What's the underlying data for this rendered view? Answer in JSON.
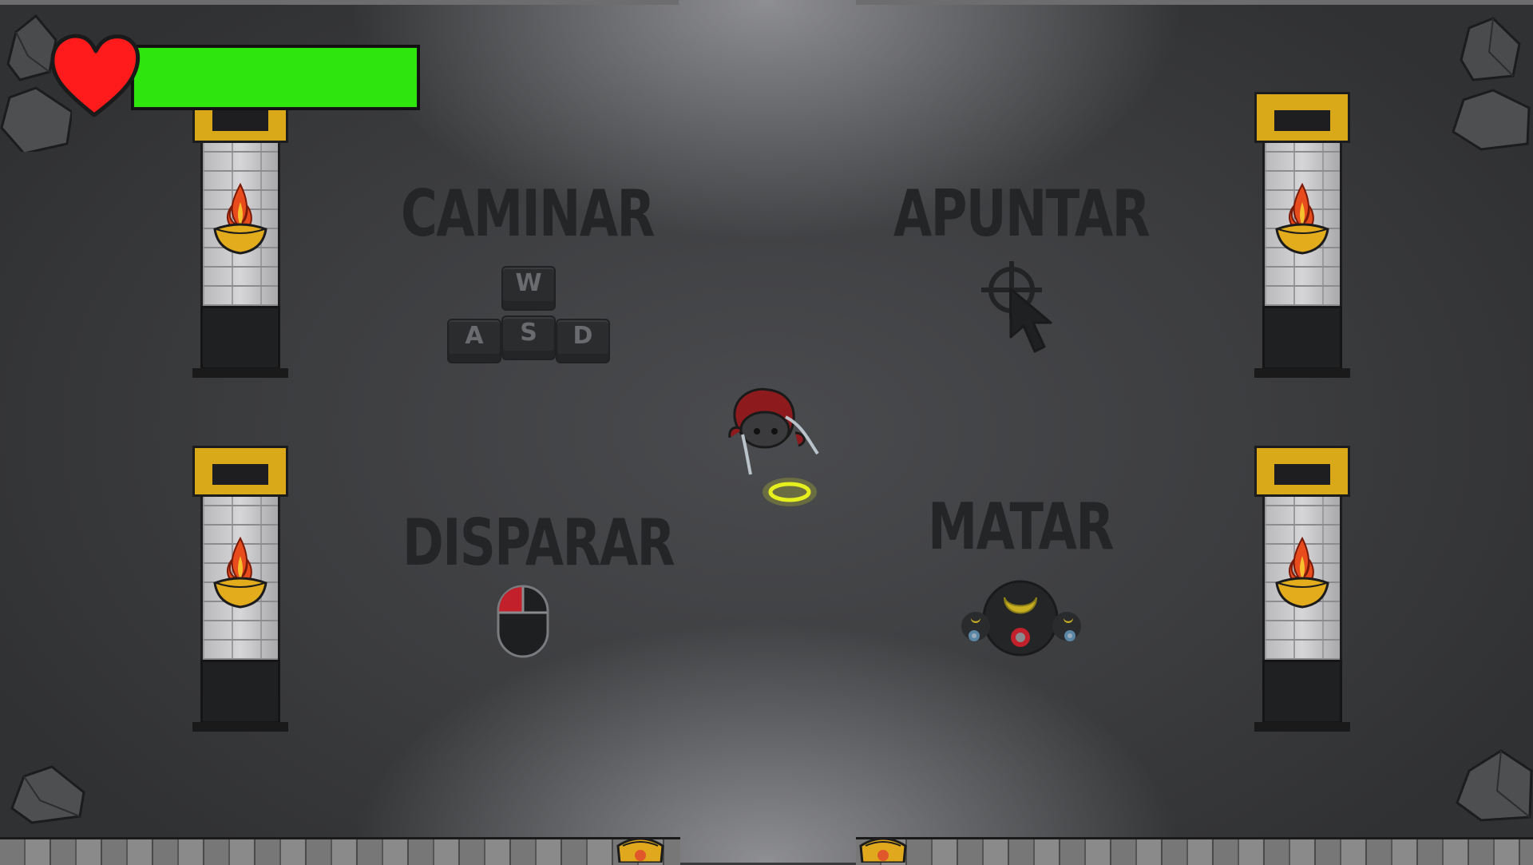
{
  "controls": {
    "walk": {
      "label": "CAMINAR",
      "keys": [
        "W",
        "A",
        "S",
        "D"
      ]
    },
    "aim": {
      "label": "APUNTAR"
    },
    "shoot": {
      "label": "DISPARAR"
    },
    "kill": {
      "label": "MATAR"
    }
  },
  "hud": {
    "health_fraction": 1.0,
    "colors": {
      "heart": "#ff1b1b",
      "health": "#2fe50e"
    }
  },
  "icons": {
    "heart": "heart-icon",
    "crosshair": "crosshair-icon",
    "cursor": "cursor-icon",
    "mouse": "mouse-left-click-icon",
    "enemy": "enemy-icon",
    "player": "player-character",
    "halo": "halo-icon"
  },
  "colors": {
    "floor": "#3a3b3d",
    "gold": "#d9a91a",
    "label": "#242526",
    "halo": "#e6f01e",
    "mouse_left": "#c2202b"
  }
}
